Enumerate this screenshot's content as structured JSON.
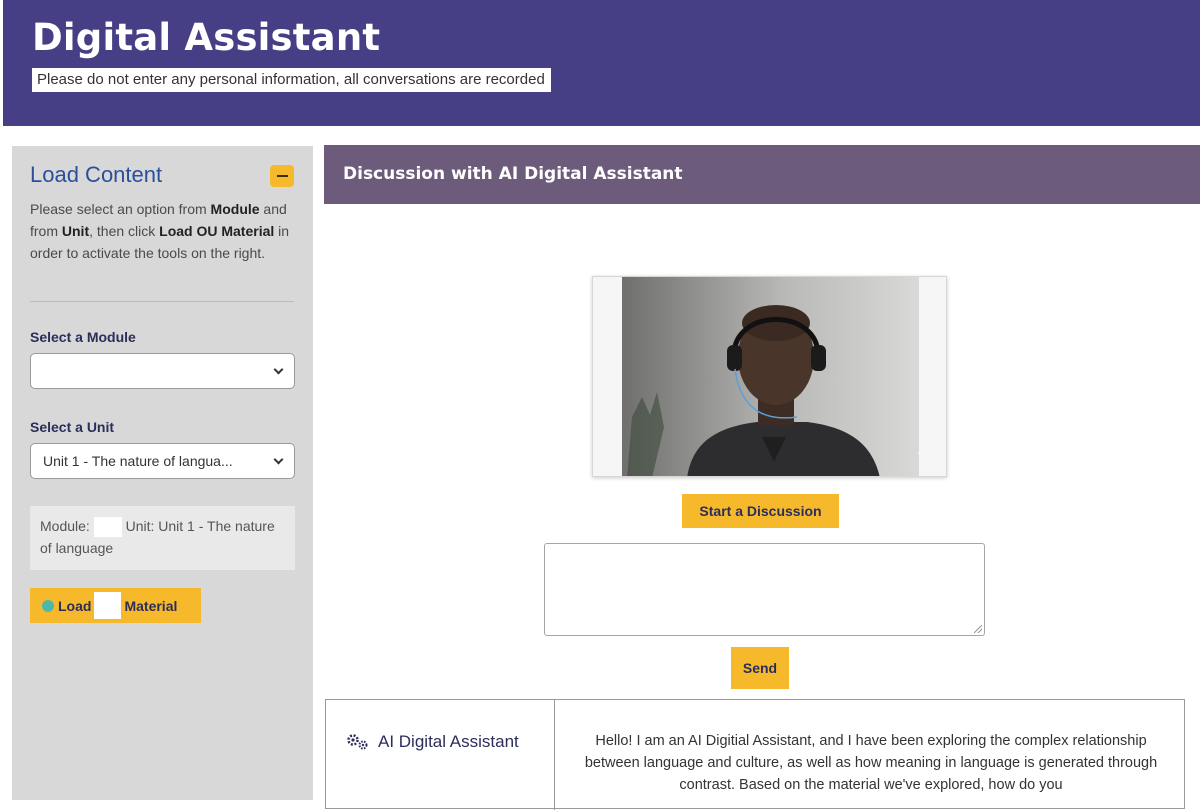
{
  "header": {
    "title": "Digital Assistant",
    "notice": "Please do not enter any personal information, all conversations are recorded"
  },
  "sidebar": {
    "title": "Load Content",
    "instructions": {
      "part1": "Please select an option from ",
      "module_word": "Module",
      "part2": " and from ",
      "unit_word": "Unit",
      "part3": ", then click ",
      "load_word": "Load OU Material",
      "part4": " in order to activate the tools on the right."
    },
    "module_label": "Select a Module",
    "module_value": "",
    "unit_label": "Select a Unit",
    "unit_value": "Unit 1 - The nature of langua...",
    "summary": {
      "module_prefix": "Module:",
      "unit_text": "Unit: Unit 1 - The nature of language"
    },
    "load_button": {
      "part1": "Load",
      "part2": "Material"
    }
  },
  "panel": {
    "title": "Discussion with AI Digital Assistant",
    "start_button": "Start a Discussion",
    "input_value": "",
    "send_button": "Send"
  },
  "chat": {
    "speaker": "AI Digital Assistant",
    "message": "Hello! I am an AI Digitial Assistant, and I have been exploring the complex relationship between language and culture, as well as how meaning in language is generated through contrast. Based on the material we've explored, how do you"
  },
  "colors": {
    "header_bg": "#463f85",
    "panel_header_bg": "#6d5b7b",
    "accent_yellow": "#f7b92c",
    "sidebar_bg": "#d8d8d8",
    "title_blue": "#2c4f9b"
  }
}
